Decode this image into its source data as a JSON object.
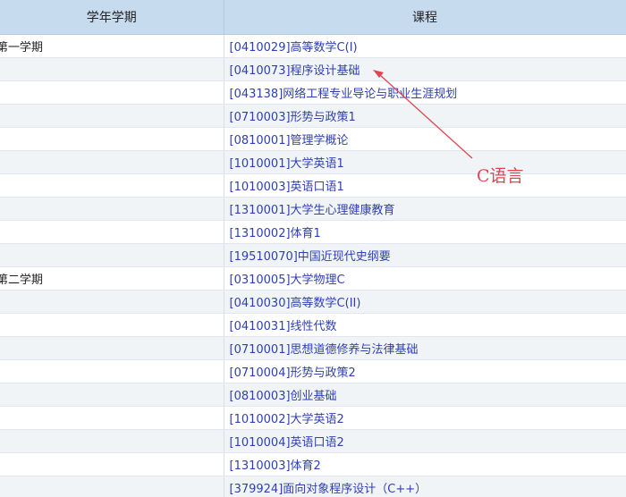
{
  "header": {
    "col_term": "学年学期",
    "col_course": "课程"
  },
  "rows": [
    {
      "term": "第一学期",
      "course": "[0410029]高等数学C(I)"
    },
    {
      "term": "",
      "course": "[0410073]程序设计基础"
    },
    {
      "term": "",
      "course": "[043138]网络工程专业导论与职业生涯规划"
    },
    {
      "term": "",
      "course": "[0710003]形势与政策1"
    },
    {
      "term": "",
      "course": "[0810001]管理学概论"
    },
    {
      "term": "",
      "course": "[1010001]大学英语1"
    },
    {
      "term": "",
      "course": "[1010003]英语口语1"
    },
    {
      "term": "",
      "course": "[1310001]大学生心理健康教育"
    },
    {
      "term": "",
      "course": "[1310002]体育1"
    },
    {
      "term": "",
      "course": "[19510070]中国近现代史纲要"
    },
    {
      "term": "第二学期",
      "course": "[0310005]大学物理C"
    },
    {
      "term": "",
      "course": "[0410030]高等数学C(II)"
    },
    {
      "term": "",
      "course": "[0410031]线性代数"
    },
    {
      "term": "",
      "course": "[0710001]思想道德修养与法律基础"
    },
    {
      "term": "",
      "course": "[0710004]形势与政策2"
    },
    {
      "term": "",
      "course": "[0810003]创业基础"
    },
    {
      "term": "",
      "course": "[1010002]大学英语2"
    },
    {
      "term": "",
      "course": "[1010004]英语口语2"
    },
    {
      "term": "",
      "course": "[1310003]体育2"
    },
    {
      "term": "",
      "course": "[379924]面向对象程序设计（C++）"
    }
  ],
  "annotation": {
    "label": "C语言",
    "color": "#e0454f"
  },
  "colors": {
    "header_bg": "#c7dbef",
    "link": "#2f3fb0",
    "row_alt": "#f1f4f7"
  }
}
